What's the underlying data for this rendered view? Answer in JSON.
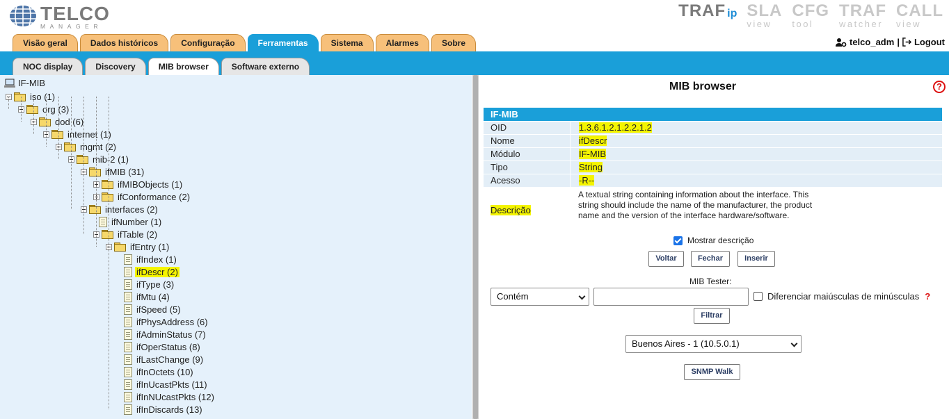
{
  "header": {
    "logo": {
      "title": "TELCO",
      "subtitle": "MANAGER"
    },
    "brands": [
      {
        "title": "TRAF",
        "suffix": "ip",
        "sub": ""
      },
      {
        "title": "SLA",
        "sub": "view"
      },
      {
        "title": "CFG",
        "sub": "tool"
      },
      {
        "title": "TRAF",
        "sub": "watcher"
      },
      {
        "title": "CALL",
        "sub": "view"
      }
    ],
    "user": {
      "name": "telco_adm",
      "separator": "|",
      "logout": "Logout"
    }
  },
  "main_tabs": [
    "Visão geral",
    "Dados históricos",
    "Configuração",
    "Ferramentas",
    "Sistema",
    "Alarmes",
    "Sobre"
  ],
  "main_tab_active": "Ferramentas",
  "sub_tabs": [
    "NOC display",
    "Discovery",
    "MIB browser",
    "Software externo"
  ],
  "sub_tab_active": "MIB browser",
  "tree": {
    "root": "IF-MIB",
    "nodes": [
      {
        "label": "iso (1)",
        "icon": "folder-open",
        "toggle": "minus"
      },
      {
        "label": "org (3)",
        "icon": "folder-open",
        "toggle": "minus"
      },
      {
        "label": "dod (6)",
        "icon": "folder-open",
        "toggle": "minus"
      },
      {
        "label": "internet (1)",
        "icon": "folder-open",
        "toggle": "minus"
      },
      {
        "label": "mgmt (2)",
        "icon": "folder-open",
        "toggle": "minus"
      },
      {
        "label": "mib-2 (1)",
        "icon": "folder-open",
        "toggle": "minus"
      },
      {
        "label": "ifMIB (31)",
        "icon": "folder-open",
        "toggle": "minus"
      },
      {
        "label": "ifMIBObjects (1)",
        "icon": "folder",
        "toggle": "plus"
      },
      {
        "label": "ifConformance (2)",
        "icon": "folder",
        "toggle": "plus"
      },
      {
        "label": "interfaces (2)",
        "icon": "folder-open",
        "toggle": "minus"
      },
      {
        "label": "ifNumber (1)",
        "icon": "document"
      },
      {
        "label": "ifTable (2)",
        "icon": "folder-open",
        "toggle": "minus"
      },
      {
        "label": "ifEntry (1)",
        "icon": "folder-open",
        "toggle": "minus"
      },
      {
        "label": "ifIndex (1)",
        "icon": "document"
      },
      {
        "label": "ifDescr (2)",
        "icon": "document",
        "selected": true
      },
      {
        "label": "ifType (3)",
        "icon": "document"
      },
      {
        "label": "ifMtu (4)",
        "icon": "document"
      },
      {
        "label": "ifSpeed (5)",
        "icon": "document"
      },
      {
        "label": "ifPhysAddress (6)",
        "icon": "document"
      },
      {
        "label": "ifAdminStatus (7)",
        "icon": "document"
      },
      {
        "label": "ifOperStatus (8)",
        "icon": "document"
      },
      {
        "label": "ifLastChange (9)",
        "icon": "document"
      },
      {
        "label": "ifInOctets (10)",
        "icon": "document"
      },
      {
        "label": "ifInUcastPkts (11)",
        "icon": "document"
      },
      {
        "label": "ifInNUcastPkts (12)",
        "icon": "document"
      },
      {
        "label": "ifInDiscards (13)",
        "icon": "document"
      }
    ]
  },
  "panel": {
    "title": "MIB browser",
    "help_icon": "?",
    "table_header": "IF-MIB",
    "rows": [
      {
        "key": "OID",
        "value": "1.3.6.1.2.1.2.2.1.2"
      },
      {
        "key": "Nome",
        "value": "ifDescr"
      },
      {
        "key": "Módulo",
        "value": "IF-MIB"
      },
      {
        "key": "Tipo",
        "value": "String"
      },
      {
        "key": "Acesso",
        "value": "-R--"
      }
    ],
    "description_label": "Descrição",
    "description": "A textual string containing information about the interface. This string should include the name of the manufacturer, the product name and the version of the interface hardware/software.",
    "show_description_label": "Mostrar descrição",
    "show_description_checked": true,
    "buttons": {
      "back": "Voltar",
      "close": "Fechar",
      "insert": "Inserir"
    },
    "tester_label": "MIB Tester:",
    "match_select": "Contém",
    "filter_value": "",
    "case_label": "Diferenciar maiúsculas de minúsculas",
    "case_help": "?",
    "filter_button": "Filtrar",
    "device_select": "Buenos Aires - 1 (10.5.0.1)",
    "walk_button": "SNMP Walk"
  },
  "colors": {
    "accent": "#1a9fd9",
    "tab_inactive": "#f7c07a",
    "tree_bg": "#e5f1fb",
    "highlight": "#f4f400"
  }
}
